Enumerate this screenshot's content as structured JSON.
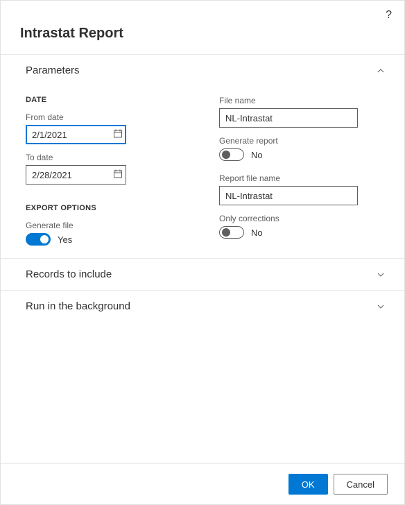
{
  "dialog": {
    "title": "Intrastat Report"
  },
  "sections": {
    "parameters": {
      "title": "Parameters"
    },
    "records": {
      "title": "Records to include"
    },
    "background": {
      "title": "Run in the background"
    }
  },
  "parameters": {
    "date_header": "DATE",
    "from_date_label": "From date",
    "from_date_value": "2/1/2021",
    "to_date_label": "To date",
    "to_date_value": "2/28/2021",
    "export_header": "EXPORT OPTIONS",
    "generate_file_label": "Generate file",
    "generate_file_value": "Yes",
    "file_name_label": "File name",
    "file_name_value": "NL-Intrastat",
    "generate_report_label": "Generate report",
    "generate_report_value": "No",
    "report_file_name_label": "Report file name",
    "report_file_name_value": "NL-Intrastat",
    "only_corrections_label": "Only corrections",
    "only_corrections_value": "No"
  },
  "footer": {
    "ok": "OK",
    "cancel": "Cancel"
  }
}
